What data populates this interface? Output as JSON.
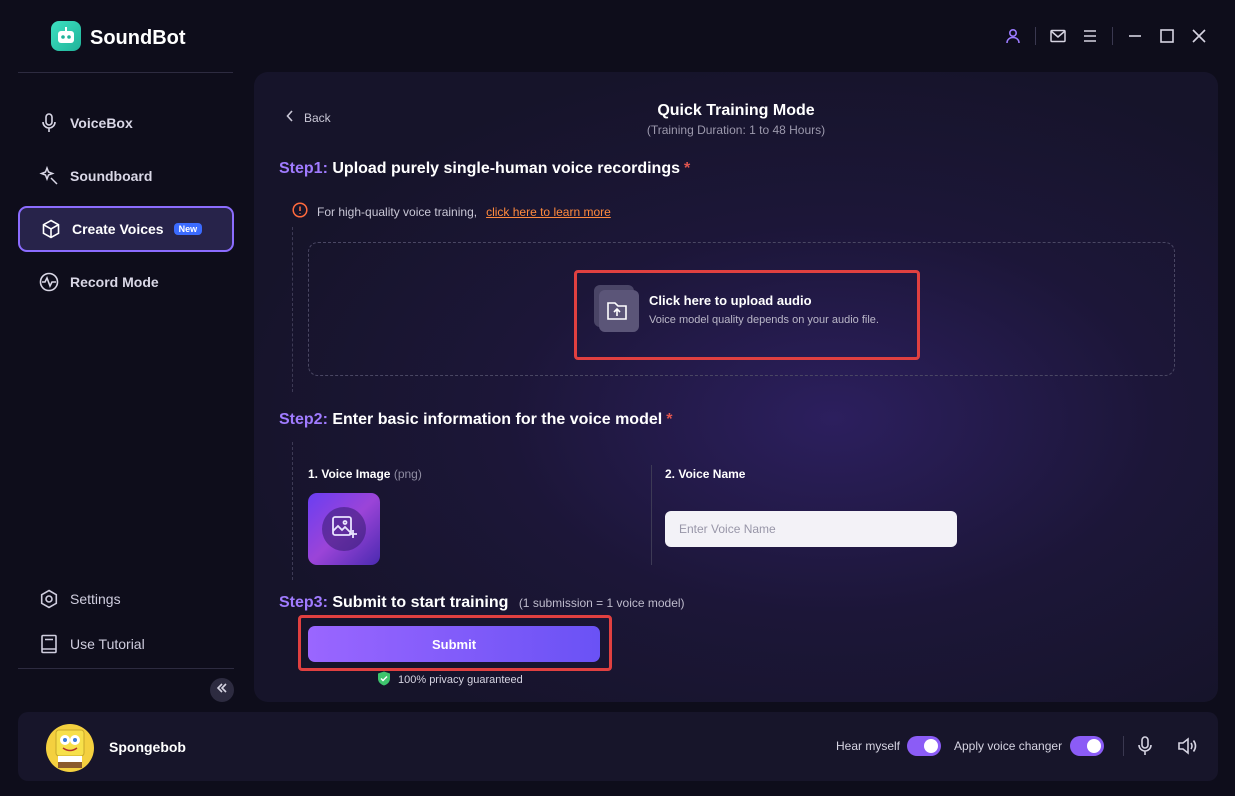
{
  "app": {
    "title": "SoundBot"
  },
  "sidebar": {
    "items": [
      {
        "label": "VoiceBox",
        "icon": "microphone-icon"
      },
      {
        "label": "Soundboard",
        "icon": "sparkle-wand-icon"
      },
      {
        "label": "Create Voices",
        "icon": "cube-icon",
        "badge": "New",
        "active": true
      },
      {
        "label": "Record Mode",
        "icon": "waveform-icon"
      }
    ],
    "bottom": [
      {
        "label": "Settings",
        "icon": "gear-icon"
      },
      {
        "label": "Use Tutorial",
        "icon": "book-icon"
      }
    ]
  },
  "main": {
    "back_label": "Back",
    "title": "Quick Training Mode",
    "subtitle": "(Training Duration: 1 to 48 Hours)",
    "step1": {
      "num": "Step1:",
      "text": "Upload purely single-human voice recordings",
      "required": "*",
      "notice_text": "For high-quality voice training,",
      "notice_link": "click here to learn more",
      "upload_title": "Click here to upload audio",
      "upload_sub": "Voice model quality depends on your audio file."
    },
    "step2": {
      "num": "Step2:",
      "text": "Enter basic information for the voice model",
      "required": "*",
      "image_label": "1. Voice Image",
      "image_hint": "(png)",
      "name_label": "2. Voice Name",
      "name_placeholder": "Enter Voice Name"
    },
    "step3": {
      "num": "Step3:",
      "text": "Submit to start training",
      "hint": "(1 submission = 1 voice model)",
      "submit_label": "Submit",
      "privacy": "100% privacy guaranteed"
    }
  },
  "bottombar": {
    "user_name": "Spongebob",
    "hear_myself": "Hear myself",
    "hear_myself_on": true,
    "apply_changer": "Apply voice changer",
    "apply_changer_on": true
  },
  "colors": {
    "accent": "#8b5cf6",
    "highlight": "#e04040",
    "link": "#ff8a3d",
    "logo": "#2fd3b2"
  }
}
